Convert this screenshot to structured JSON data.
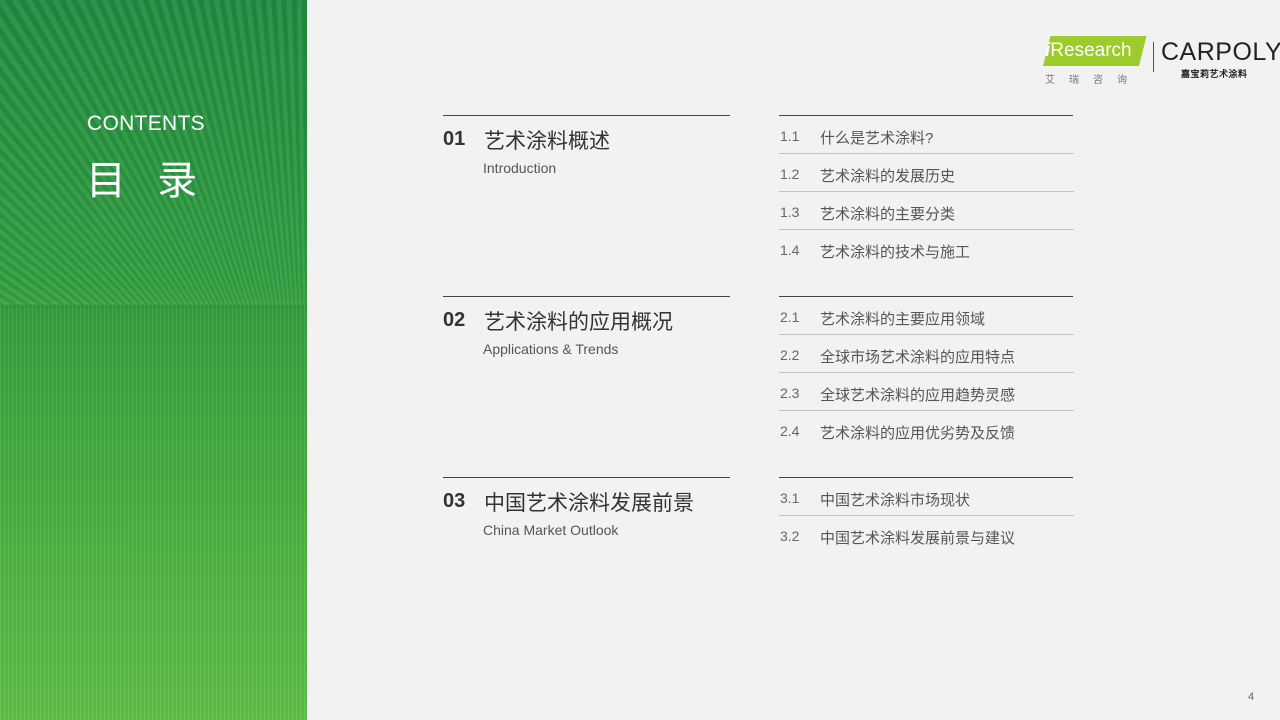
{
  "side": {
    "contents_en": "CONTENTS",
    "contents_zh": "目 录",
    "accent_color": "#2f9a40"
  },
  "logos": {
    "iresearch_prefix": "i",
    "iresearch_name": "Research",
    "iresearch_zh": "艾瑞咨询",
    "carpoly_name": "CARPOLY",
    "carpoly_zh": "嘉宝莉艺术涂料"
  },
  "sections": [
    {
      "number": "01",
      "title": "艺术涂料概述",
      "subtitle": "Introduction",
      "items": [
        {
          "num": "1.1",
          "text": "什么是艺术涂料?"
        },
        {
          "num": "1.2",
          "text": "艺术涂料的发展历史"
        },
        {
          "num": "1.3",
          "text": "艺术涂料的主要分类"
        },
        {
          "num": "1.4",
          "text": "艺术涂料的技术与施工"
        }
      ]
    },
    {
      "number": "02",
      "title": "艺术涂料的应用概况",
      "subtitle": "Applications & Trends",
      "items": [
        {
          "num": "2.1",
          "text": "艺术涂料的主要应用领域"
        },
        {
          "num": "2.2",
          "text": "全球市场艺术涂料的应用特点"
        },
        {
          "num": "2.3",
          "text": "全球艺术涂料的应用趋势灵感"
        },
        {
          "num": "2.4",
          "text": "艺术涂料的应用优劣势及反馈"
        }
      ]
    },
    {
      "number": "03",
      "title": "中国艺术涂料发展前景",
      "subtitle": "China Market Outlook",
      "items": [
        {
          "num": "3.1",
          "text": "中国艺术涂料市场现状"
        },
        {
          "num": "3.2",
          "text": "中国艺术涂料发展前景与建议"
        }
      ]
    }
  ],
  "page_number": "4"
}
